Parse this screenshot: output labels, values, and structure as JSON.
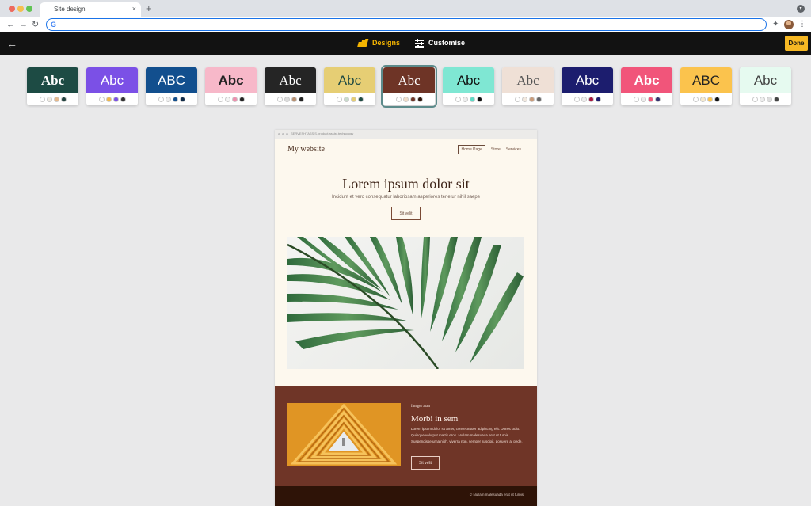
{
  "browser": {
    "tab_title": "Site design",
    "new_tab": "+",
    "close": "×",
    "url": ""
  },
  "app": {
    "back": "←",
    "nav": [
      {
        "label": "Designs",
        "active": true,
        "icon": "designs-icon"
      },
      {
        "label": "Customise",
        "active": false,
        "icon": "sliders-icon"
      }
    ],
    "done_label": "Done",
    "accent": "#f6b824"
  },
  "themes": [
    {
      "label": "Abc",
      "bg": "#1d4b44",
      "fg": "#ffffff",
      "font": "serif",
      "weight": "bold",
      "dots": [
        "#ffffff",
        "#f0ebe2",
        "#e6b98c",
        "#22433f"
      ]
    },
    {
      "label": "Abc",
      "bg": "#7b50e6",
      "fg": "#ffffff",
      "font": "sans",
      "weight": "normal",
      "dots": [
        "#ffffff",
        "#f0b84a",
        "#7b50e6",
        "#333333"
      ]
    },
    {
      "label": "ABC",
      "bg": "#124f8e",
      "fg": "#ffffff",
      "font": "sans",
      "weight": "normal",
      "dots": [
        "#ffffff",
        "#eeeeee",
        "#124f8e",
        "#0f2a48"
      ]
    },
    {
      "label": "Abc",
      "bg": "#f7b8c9",
      "fg": "#222222",
      "font": "sans",
      "weight": "bold",
      "dots": [
        "#ffffff",
        "#f5f5f5",
        "#ef8fae",
        "#222222"
      ]
    },
    {
      "label": "Abc",
      "bg": "#252525",
      "fg": "#ffffff",
      "font": "serif",
      "weight": "normal",
      "dots": [
        "#ffffff",
        "#dddddd",
        "#b89070",
        "#222222"
      ]
    },
    {
      "label": "Abc",
      "bg": "#e6ce74",
      "fg": "#1e4a43",
      "font": "sans",
      "weight": "normal",
      "dots": [
        "#ffffff",
        "#c9dccc",
        "#e6ce74",
        "#1e4a43"
      ]
    },
    {
      "label": "Abc",
      "bg": "#6e3426",
      "fg": "#ffffff",
      "font": "serif",
      "weight": "normal",
      "dots": [
        "#ffffff",
        "#f1dcc7",
        "#6e3426",
        "#2e140a"
      ],
      "selected": true
    },
    {
      "label": "Abc",
      "bg": "#7fe7d3",
      "fg": "#111111",
      "font": "sans",
      "weight": "normal",
      "dots": [
        "#ffffff",
        "#eeeeee",
        "#5fdac6",
        "#111111"
      ]
    },
    {
      "label": "Abc",
      "bg": "#efe0d6",
      "fg": "#555555",
      "font": "serif",
      "weight": "normal",
      "dots": [
        "#ffffff",
        "#f3e9df",
        "#c99b7a",
        "#666666"
      ]
    },
    {
      "label": "Abc",
      "bg": "#1c1d6e",
      "fg": "#ffffff",
      "font": "sans",
      "weight": "normal",
      "dots": [
        "#ffffff",
        "#eeeeee",
        "#a8173f",
        "#1c1d6e"
      ]
    },
    {
      "label": "Abc",
      "bg": "#f1557a",
      "fg": "#ffffff",
      "font": "sans",
      "weight": "bold",
      "dots": [
        "#ffffff",
        "#eeeeee",
        "#f1557a",
        "#34316e"
      ]
    },
    {
      "label": "ABC",
      "bg": "#fbc34d",
      "fg": "#222222",
      "font": "sans",
      "weight": "normal",
      "dots": [
        "#ffffff",
        "#f6ebd0",
        "#fbc34d",
        "#111111"
      ]
    },
    {
      "label": "Abc",
      "bg": "#e6faf0",
      "fg": "#444444",
      "font": "sans",
      "weight": "normal",
      "dots": [
        "#ffffff",
        "#eeeeee",
        "#dddddd",
        "#444444"
      ]
    }
  ],
  "preview": {
    "url": "SERVESHTASSIS.product.assist.technology",
    "brand": "My website",
    "nav": [
      "Home Page",
      "Store",
      "Services"
    ],
    "hero": {
      "title": "Lorem ipsum dolor sit",
      "subtitle": "Incidunt et vero consequatur laboriosam asperiores tenetur nihil saepe",
      "button": "Sit velit"
    },
    "section": {
      "eyebrow": "Integer aran",
      "title": "Morbi in sem",
      "body": "Lorem ipsum dolor sit amet, consectetuer adipiscing elit. Donec odio. Quisque volutpat mattis eros. Nullam malesuada erat ut turpis. Suspendisse urna nibh, viverra non, semper suscipit, posuere a, pede.",
      "button": "Sit velit"
    },
    "footer": "© Nullam malesuada erat ut turpis"
  }
}
